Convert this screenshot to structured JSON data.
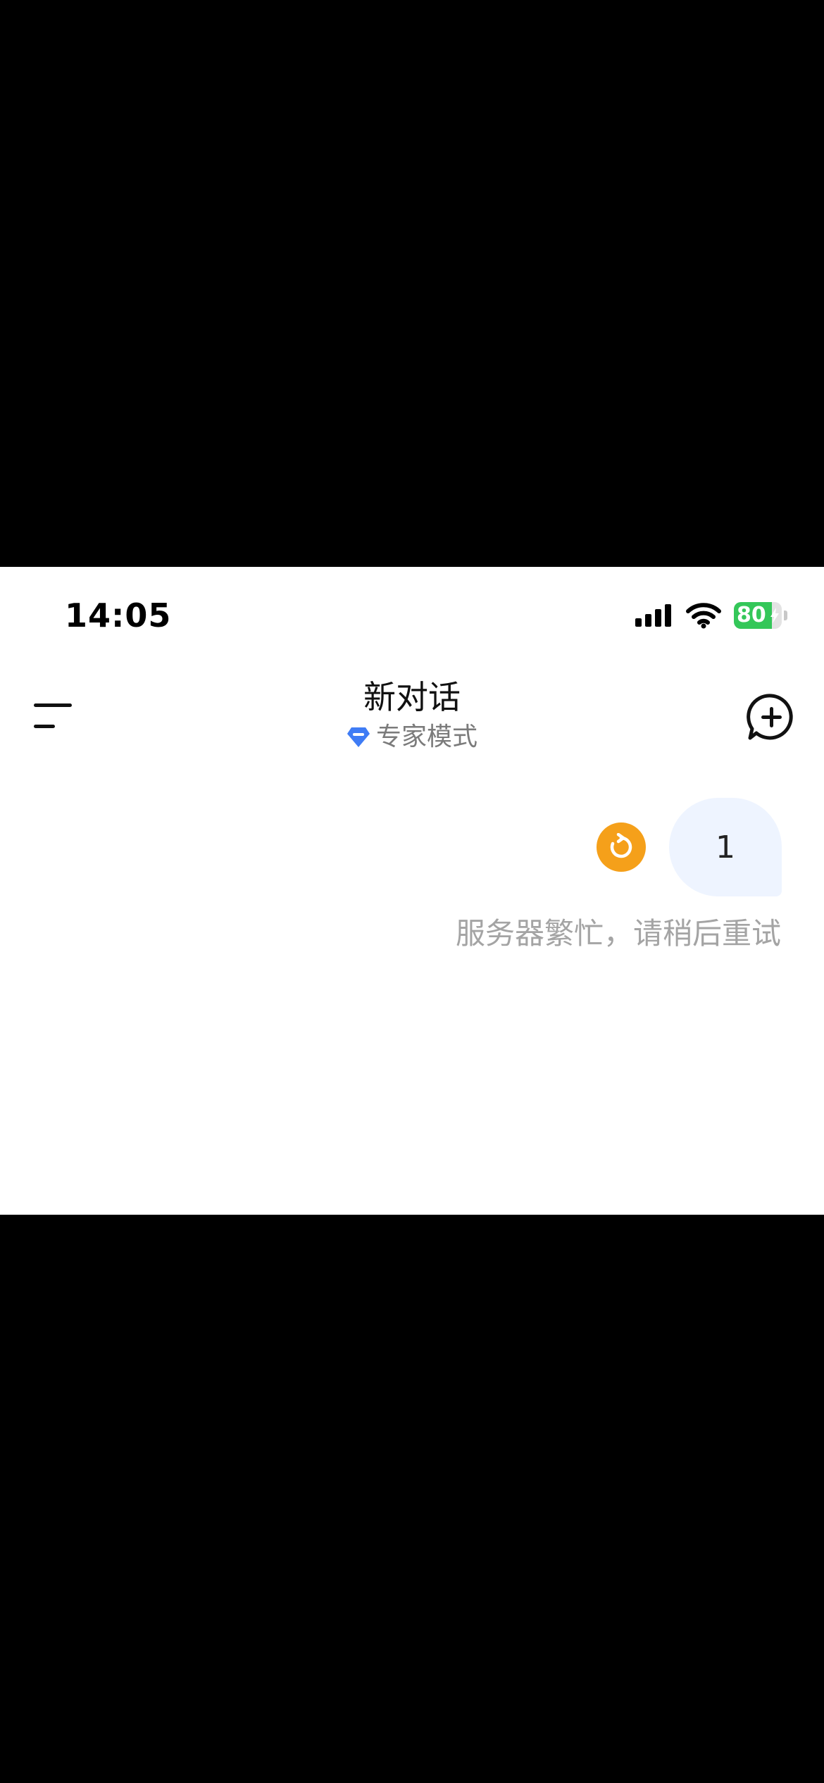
{
  "status_bar": {
    "time": "14:05",
    "battery_level": "80",
    "battery_fraction": 0.8,
    "icons": [
      "cellular-signal-icon",
      "wifi-icon",
      "battery-icon",
      "charging-bolt-icon"
    ]
  },
  "header": {
    "title": "新对话",
    "mode_label": "专家模式",
    "mode_icon": "diamond-icon",
    "menu_icon": "menu-icon",
    "new_chat_icon": "new-chat-plus-icon"
  },
  "conversation": {
    "user_message": "1",
    "retry_icon": "retry-icon",
    "error_message": "服务器繁忙，请稍后重试"
  },
  "colors": {
    "accent_blue": "#3f7cf5",
    "retry_orange": "#f5a01a",
    "bubble_bg": "#eef4ff",
    "battery_green": "#34c759",
    "muted_text": "#a4a4a4"
  }
}
